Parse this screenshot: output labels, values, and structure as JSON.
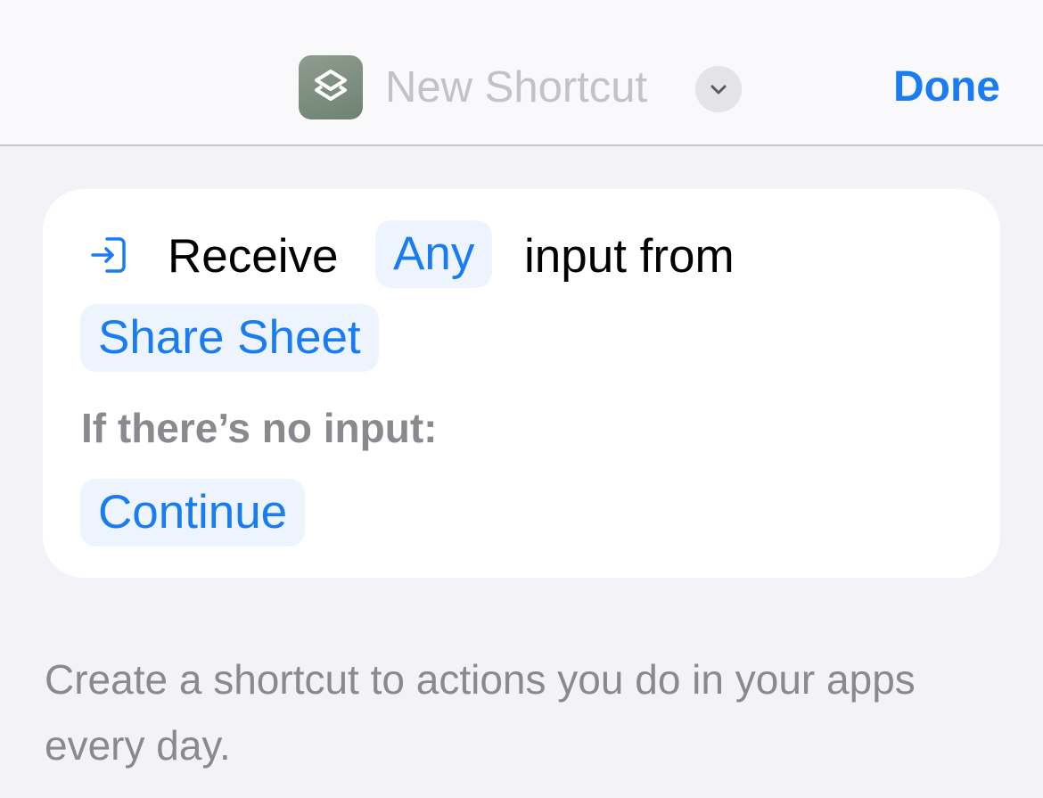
{
  "nav": {
    "title": "New Shortcut",
    "done_label": "Done",
    "app_icon": "shortcuts-layers-icon",
    "menu_icon": "chevron-down-icon"
  },
  "action": {
    "icon": "receive-input-icon",
    "receive_label": "Receive",
    "input_type": "Any",
    "from_label": "input from",
    "source": "Share Sheet",
    "no_input_label": "If there’s no input:",
    "no_input_value": "Continue"
  },
  "description": "Create a shortcut to actions you do in your apps every day.",
  "colors": {
    "accent": "#1a7cf2",
    "token_background": "#edf4fe",
    "app_icon": "#7d8f80",
    "secondary_text": "#8a8a8e",
    "background": "#f2f2f7"
  }
}
